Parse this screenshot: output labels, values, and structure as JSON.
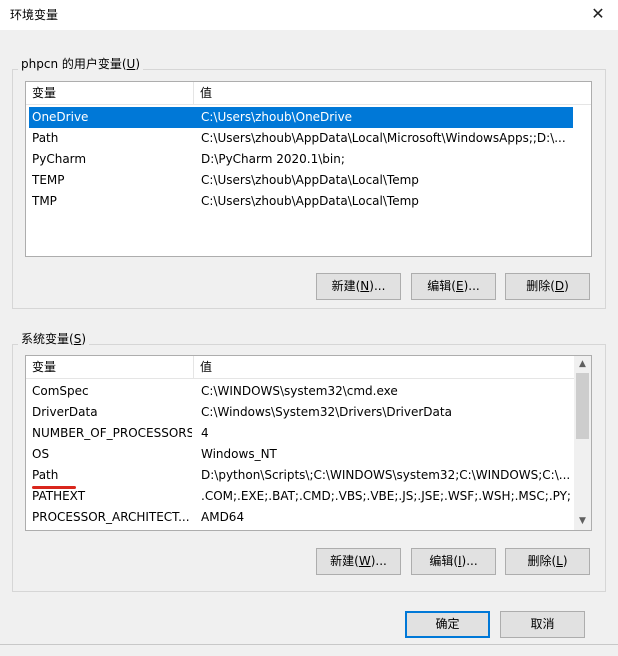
{
  "window": {
    "title": "环境变量",
    "close_glyph": "✕"
  },
  "user_vars": {
    "group_label_prefix": "phpcn 的用户变量(",
    "group_label_key": "U",
    "group_label_suffix": ")",
    "col_name": "变量",
    "col_value": "值",
    "rows": [
      {
        "name": "OneDrive",
        "value": "C:\\Users\\zhoub\\OneDrive"
      },
      {
        "name": "Path",
        "value": "C:\\Users\\zhoub\\AppData\\Local\\Microsoft\\WindowsApps;;D:\\..."
      },
      {
        "name": "PyCharm",
        "value": "D:\\PyCharm 2020.1\\bin;"
      },
      {
        "name": "TEMP",
        "value": "C:\\Users\\zhoub\\AppData\\Local\\Temp"
      },
      {
        "name": "TMP",
        "value": "C:\\Users\\zhoub\\AppData\\Local\\Temp"
      }
    ],
    "buttons": {
      "new": {
        "prefix": "新建(",
        "key": "N",
        "suffix": ")..."
      },
      "edit": {
        "prefix": "编辑(",
        "key": "E",
        "suffix": ")..."
      },
      "delete": {
        "prefix": "删除(",
        "key": "D",
        "suffix": ")"
      }
    }
  },
  "system_vars": {
    "group_label_prefix": "系统变量(",
    "group_label_key": "S",
    "group_label_suffix": ")",
    "col_name": "变量",
    "col_value": "值",
    "rows": [
      {
        "name": "ComSpec",
        "value": "C:\\WINDOWS\\system32\\cmd.exe"
      },
      {
        "name": "DriverData",
        "value": "C:\\Windows\\System32\\Drivers\\DriverData"
      },
      {
        "name": "NUMBER_OF_PROCESSORS",
        "value": "4"
      },
      {
        "name": "OS",
        "value": "Windows_NT"
      },
      {
        "name": "Path",
        "value": "D:\\python\\Scripts\\;C:\\WINDOWS\\system32;C:\\WINDOWS;C:\\..."
      },
      {
        "name": "PATHEXT",
        "value": ".COM;.EXE;.BAT;.CMD;.VBS;.VBE;.JS;.JSE;.WSF;.WSH;.MSC;.PY;.P..."
      },
      {
        "name": "PROCESSOR_ARCHITECT...",
        "value": "AMD64"
      }
    ],
    "buttons": {
      "new": {
        "prefix": "新建(",
        "key": "W",
        "suffix": ")..."
      },
      "edit": {
        "prefix": "编辑(",
        "key": "I",
        "suffix": ")..."
      },
      "delete": {
        "prefix": "删除(",
        "key": "L",
        "suffix": ")"
      }
    },
    "scroll_up_glyph": "▲",
    "scroll_down_glyph": "▼"
  },
  "footer": {
    "ok_label": "确定",
    "cancel_label": "取消"
  },
  "colors": {
    "selection": "#0078d7",
    "annotation_underline": "#d9261c"
  }
}
